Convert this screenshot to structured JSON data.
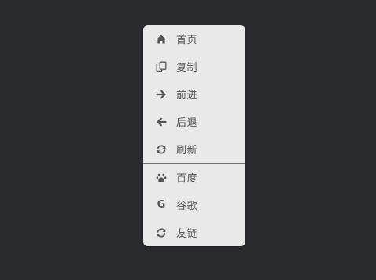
{
  "menu": {
    "group1": [
      {
        "label": "首页",
        "icon": "home-icon"
      },
      {
        "label": "复制",
        "icon": "copy-icon"
      },
      {
        "label": "前进",
        "icon": "arrow-right-icon"
      },
      {
        "label": "后退",
        "icon": "arrow-left-icon"
      },
      {
        "label": "刷新",
        "icon": "refresh-icon"
      }
    ],
    "group2": [
      {
        "label": "百度",
        "icon": "paw-icon"
      },
      {
        "label": "谷歌",
        "icon": "google-icon"
      },
      {
        "label": "友链",
        "icon": "refresh-icon"
      }
    ]
  },
  "colors": {
    "background": "#2a2b2f",
    "menu_background": "#e9e9e9",
    "text": "#555555",
    "divider": "#707070"
  }
}
